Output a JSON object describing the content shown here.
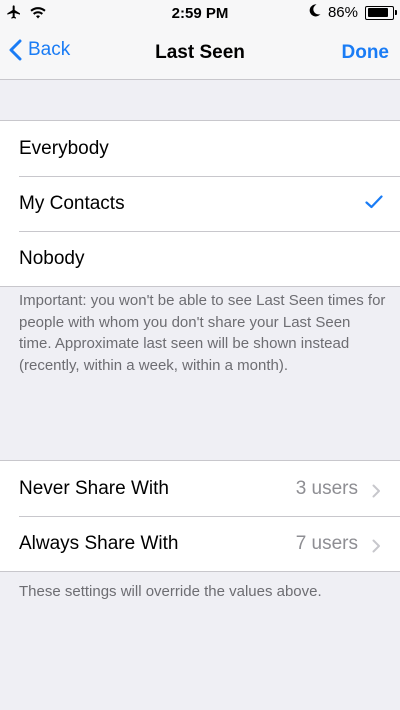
{
  "status_bar": {
    "time": "2:59 PM",
    "battery_text": "86%",
    "battery_level": 0.86,
    "icons": [
      "airplane-icon",
      "wifi-icon",
      "moon-icon",
      "battery-icon"
    ]
  },
  "nav": {
    "back_label": "Back",
    "title": "Last Seen",
    "done_label": "Done",
    "accent_color": "#1a7cf5"
  },
  "visibility_options": [
    {
      "label": "Everybody",
      "selected": false
    },
    {
      "label": "My Contacts",
      "selected": true
    },
    {
      "label": "Nobody",
      "selected": false
    }
  ],
  "visibility_note": "Important: you won't be able to see Last Seen times for people with whom you don't share your Last Seen time. Approximate last seen will be shown instead (recently, within a week, within a month).",
  "exceptions": [
    {
      "label": "Never Share With",
      "value": "3 users"
    },
    {
      "label": "Always Share With",
      "value": "7 users"
    }
  ],
  "exceptions_note": "These settings will override the values above."
}
